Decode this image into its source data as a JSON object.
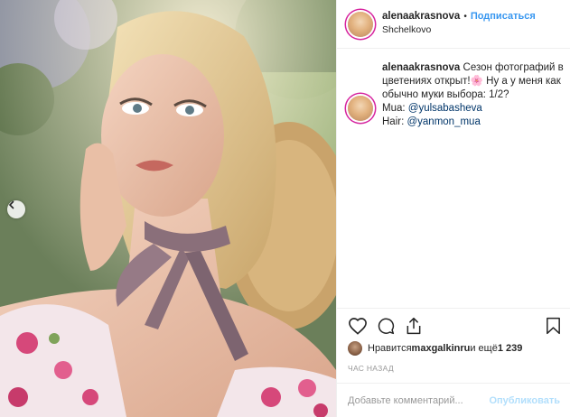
{
  "post": {
    "username": "alenaakrasnova",
    "follow_label": "Подписаться",
    "separator": "•",
    "location": "Shchelkovo"
  },
  "caption": {
    "username": "alenaakrasnova",
    "text_part1": "Сезон фотографий в цветениях открыт!",
    "emoji": "🌸",
    "text_part2": " Ну а у меня как обычно муки выбора: 1/2?",
    "mua_label": "Mua: ",
    "mua_handle": "@yulsabasheva",
    "hair_label": "Hair: ",
    "hair_handle": "@yanmon_mua"
  },
  "likes": {
    "prefix": "Нравится ",
    "user": "maxgalkinru",
    "suffix": " и ещё ",
    "count": "1 239"
  },
  "timestamp": "ЧАС НАЗАД",
  "comment": {
    "placeholder": "Добавьте комментарий...",
    "value": "",
    "publish_label": "Опубликовать"
  },
  "icons": {
    "like": "heart-icon",
    "comment": "comment-icon",
    "share": "share-icon",
    "save": "bookmark-icon",
    "carousel_prev": "chevron-left-icon"
  },
  "colors": {
    "follow": "#3897f0",
    "publish_disabled": "#b2dffc",
    "muted": "#999999",
    "mention": "#003569"
  }
}
